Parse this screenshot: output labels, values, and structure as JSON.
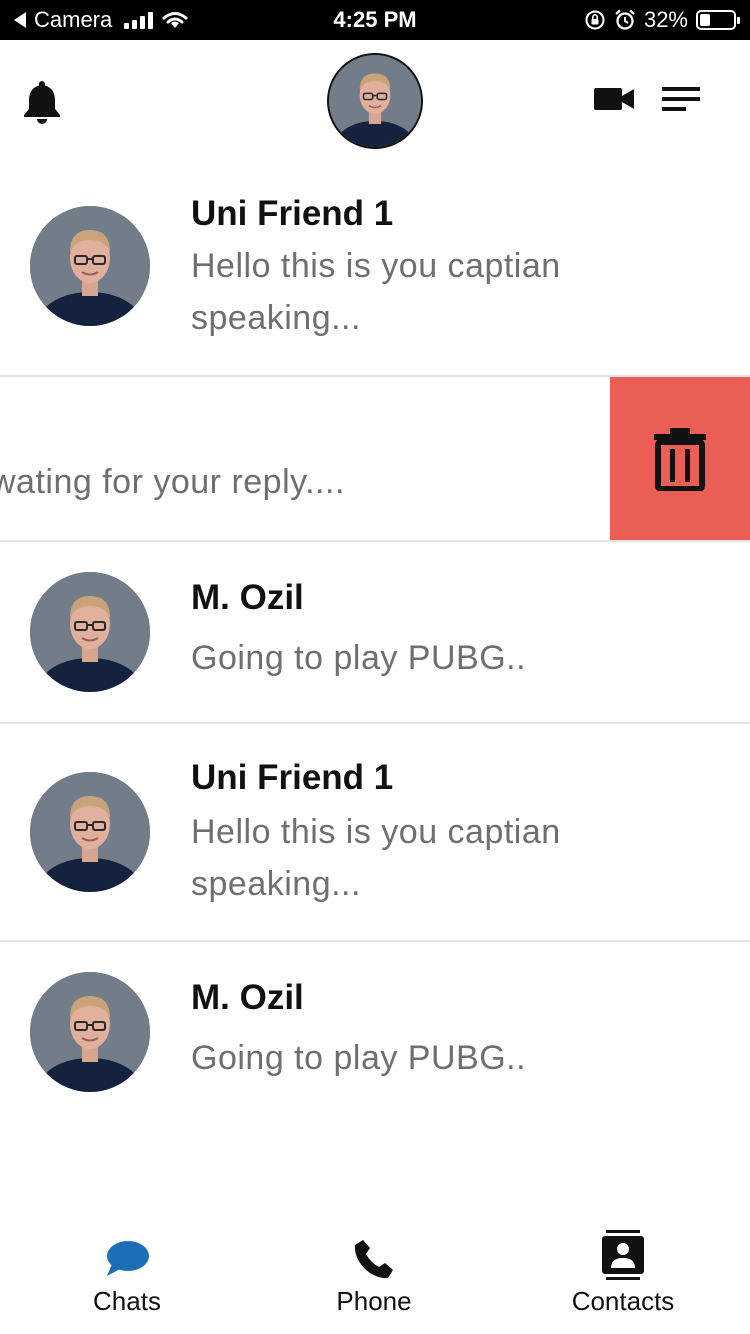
{
  "status_bar": {
    "back_label": "Camera",
    "time": "4:25 PM",
    "battery_text": "32%",
    "battery_level": 0.32
  },
  "header": {
    "icons": [
      "bell-icon",
      "profile-avatar",
      "video-camera-icon",
      "menu-icon"
    ]
  },
  "chats": [
    {
      "name": "Uni Friend 1",
      "message": "Hello this is you captian speaking..."
    },
    {
      "name": "",
      "message": "wating for your reply...."
    },
    {
      "name": "M. Ozil",
      "message": "Going to play PUBG.."
    },
    {
      "name": "Uni Friend 1",
      "message": "Hello this is you captian speaking..."
    },
    {
      "name": "M. Ozil",
      "message": "Going to play PUBG.."
    }
  ],
  "swipe_action": {
    "icon": "trash-icon",
    "color": "#eb5e55"
  },
  "tabs": [
    {
      "label": "Chats",
      "icon": "chat-bubble-icon",
      "active": true,
      "color": "#1d6fb5"
    },
    {
      "label": "Phone",
      "icon": "phone-icon",
      "active": false,
      "color": "#111111"
    },
    {
      "label": "Contacts",
      "icon": "contacts-icon",
      "active": false,
      "color": "#111111"
    }
  ]
}
